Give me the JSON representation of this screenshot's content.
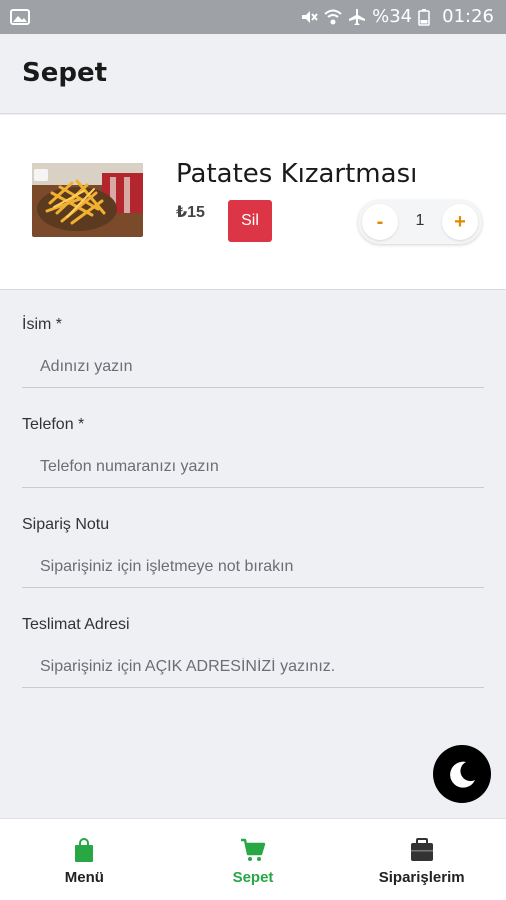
{
  "status_bar": {
    "battery": "%34",
    "time": "01:26",
    "icons": [
      "gallery-icon",
      "mute-icon",
      "wifi-icon",
      "airplane-icon",
      "battery-icon"
    ]
  },
  "header": {
    "title": "Sepet"
  },
  "cart": {
    "item": {
      "name": "Patates Kızartması",
      "price": "₺15",
      "delete_label": "Sil",
      "quantity": "1",
      "minus_label": "-",
      "plus_label": "+"
    }
  },
  "form": {
    "fields": [
      {
        "label": "İsim *",
        "placeholder": "Adınızı yazın"
      },
      {
        "label": "Telefon *",
        "placeholder": "Telefon numaranızı yazın"
      },
      {
        "label": "Sipariş Notu",
        "placeholder": "Siparişiniz için işletmeye not bırakın"
      },
      {
        "label": "Teslimat Adresi",
        "placeholder": "Siparişiniz için AÇIK ADRESİNİZİ yazınız."
      }
    ]
  },
  "nav": {
    "items": [
      {
        "label": "Menü",
        "icon": "shopping-bag-icon"
      },
      {
        "label": "Sepet",
        "icon": "cart-icon"
      },
      {
        "label": "Siparişlerim",
        "icon": "briefcase-icon"
      }
    ]
  },
  "colors": {
    "accent": "#28a745",
    "danger": "#dc3545",
    "qty_sign": "#e08a00"
  }
}
